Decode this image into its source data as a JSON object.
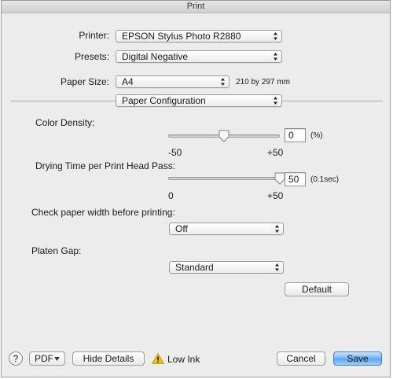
{
  "window": {
    "title": "Print"
  },
  "printer": {
    "label": "Printer:",
    "value": "EPSON Stylus Photo R2880"
  },
  "presets": {
    "label": "Presets:",
    "value": "Digital Negative"
  },
  "paper_size": {
    "label": "Paper Size:",
    "value": "A4",
    "dimensions": "210 by 297 mm"
  },
  "panel": {
    "value": "Paper Configuration"
  },
  "color_density": {
    "label": "Color Density:",
    "value": "0",
    "unit": "(%)",
    "min_label": "-50",
    "max_label": "+50",
    "min": -50,
    "max": 50,
    "level": 0
  },
  "drying_time": {
    "label": "Drying Time per Print Head Pass:",
    "value": "50",
    "unit": "(0.1sec)",
    "min_label": "0",
    "max_label": "+50",
    "min": 0,
    "max": 50,
    "level": 50
  },
  "check_paper_width": {
    "label": "Check paper width before printing:",
    "value": "Off"
  },
  "platen_gap": {
    "label": "Platen Gap:",
    "value": "Standard"
  },
  "buttons": {
    "default": "Default",
    "help": "?",
    "pdf": "PDF",
    "hide_details": "Hide Details",
    "cancel": "Cancel",
    "save": "Save"
  },
  "status": {
    "low_ink": "Low Ink"
  },
  "icons": {
    "popup_arrows": "updown-arrows-icon",
    "pdf_menu": "triangle-down-icon",
    "warning": "warning-triangle-icon",
    "slider_knob": "slider-knob-icon"
  },
  "colors": {
    "accent": "#5aa4f0",
    "warning": "#f5c400"
  }
}
